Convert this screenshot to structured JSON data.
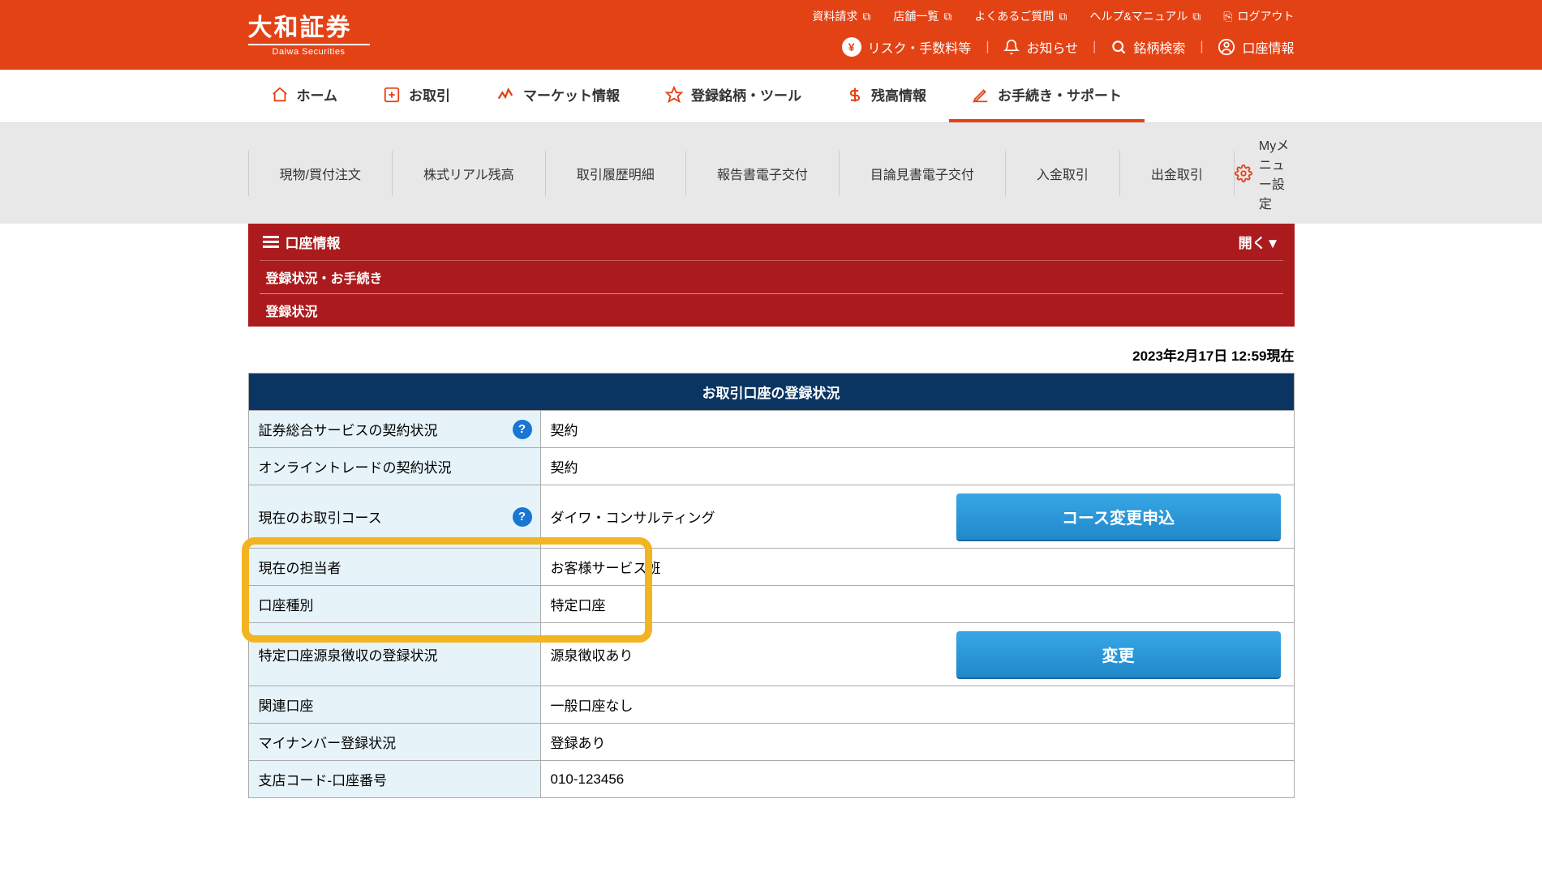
{
  "brand": {
    "name": "大和証券",
    "sub": "Daiwa Securities"
  },
  "top_links": [
    "資料請求",
    "店舗一覧",
    "よくあるご質問",
    "ヘルプ&マニュアル",
    "ログアウト"
  ],
  "top_menu": {
    "risk": "リスク・手数料等",
    "notice": "お知らせ",
    "search": "銘柄検索",
    "account": "口座情報"
  },
  "nav": {
    "home": "ホーム",
    "trade": "お取引",
    "market": "マーケット情報",
    "saved": "登録銘柄・ツール",
    "balance": "残高情報",
    "support": "お手続き・サポート"
  },
  "subnav": [
    "現物/買付注文",
    "株式リアル残高",
    "取引履歴明細",
    "報告書電子交付",
    "目論見書電子交付",
    "入金取引",
    "出金取引"
  ],
  "mymenu": "Myメニュー設定",
  "strip": {
    "title": "口座情報",
    "expand": "開く▼",
    "line1": "登録状況・お手続き",
    "line2": "登録状況"
  },
  "timestamp": "2023年2月17日  12:59現在",
  "table": {
    "title": "お取引口座の登録状況",
    "rows": [
      {
        "label": "証券総合サービスの契約状況",
        "value": "契約",
        "help": true
      },
      {
        "label": "オンライントレードの契約状況",
        "value": "契約"
      },
      {
        "label": "現在のお取引コース",
        "value": "ダイワ・コンサルティング",
        "help": true,
        "button": "コース変更申込"
      },
      {
        "label": "現在の担当者",
        "value": "お客様サービス班"
      },
      {
        "label": "口座種別",
        "value": "特定口座"
      },
      {
        "label": "特定口座源泉徴収の登録状況",
        "value": "源泉徴収あり",
        "button": "変更"
      },
      {
        "label": "関連口座",
        "value": "一般口座なし"
      },
      {
        "label": "マイナンバー登録状況",
        "value": "登録あり"
      },
      {
        "label": "支店コード-口座番号",
        "value": "010-123456"
      }
    ]
  }
}
